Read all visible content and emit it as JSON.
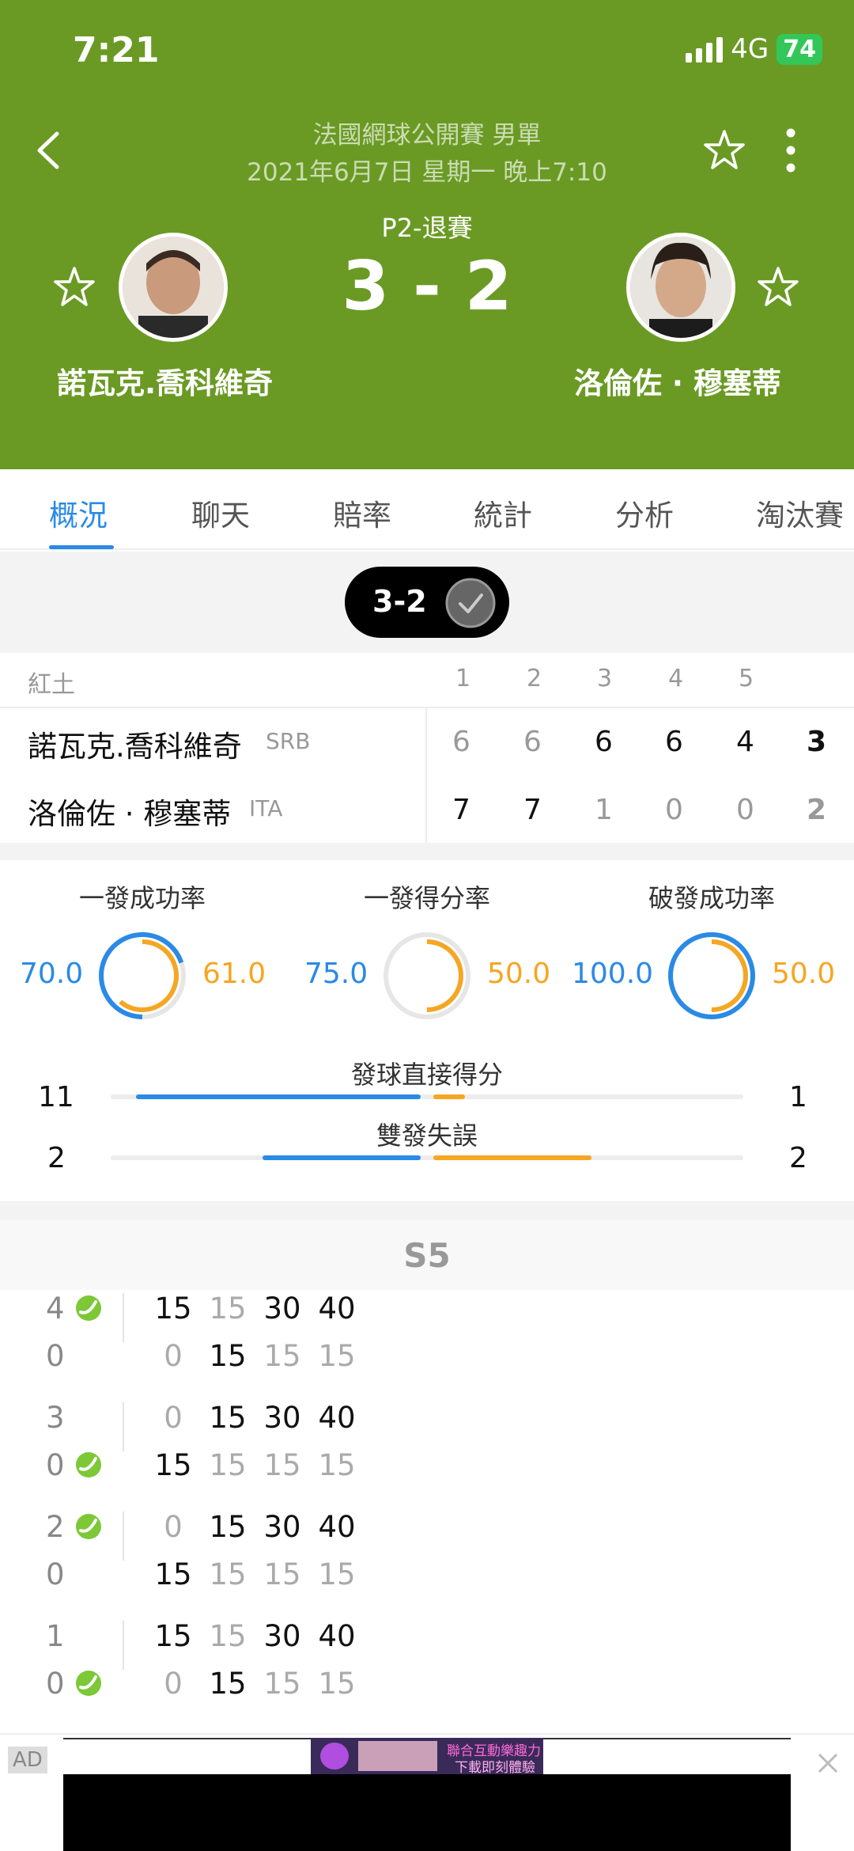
{
  "status_bar": {
    "time": "7:21",
    "network": "4G",
    "battery": "74"
  },
  "header": {
    "tournament": "法國網球公開賽 男單",
    "datetime": "2021年6月7日 星期一 晚上7:10",
    "match_status": "P2-退賽",
    "score": "3 - 2",
    "player1": {
      "name": "諾瓦克.喬科維奇"
    },
    "player2": {
      "name": "洛倫佐 · 穆塞蒂"
    }
  },
  "tabs": [
    "概況",
    "聊天",
    "賠率",
    "統計",
    "分析",
    "淘汰賽"
  ],
  "pill": {
    "score": "3-2"
  },
  "scoreboard": {
    "surface": "紅土",
    "set_headers": [
      "1",
      "2",
      "3",
      "4",
      "5"
    ],
    "rows": [
      {
        "name": "諾瓦克.喬科維奇",
        "country": "SRB",
        "sets": [
          "6",
          "6",
          "6",
          "6",
          "4"
        ],
        "total": "3"
      },
      {
        "name": "洛倫佐 · 穆塞蒂",
        "country": "ITA",
        "sets": [
          "7",
          "7",
          "1",
          "0",
          "0"
        ],
        "total": "2"
      }
    ]
  },
  "stats": {
    "circles": [
      {
        "label": "一發成功率",
        "left": "70.0",
        "right": "61.0"
      },
      {
        "label": "一發得分率",
        "left": "75.0",
        "right": "50.0"
      },
      {
        "label": "破發成功率",
        "left": "100.0",
        "right": "50.0"
      }
    ],
    "bars": [
      {
        "label": "發球直接得分",
        "left": "11",
        "right": "1"
      },
      {
        "label": "雙發失誤",
        "left": "2",
        "right": "2"
      }
    ]
  },
  "set_detail": {
    "title": "S5",
    "games": [
      {
        "top_score": "4",
        "bottom_score": "0",
        "server": "top",
        "top_points": [
          "15",
          "15",
          "30",
          "40"
        ],
        "bottom_points": [
          "0",
          "15",
          "15",
          "15"
        ],
        "top_bold": [
          1,
          0,
          1,
          1
        ],
        "bottom_bold": [
          0,
          1,
          0,
          0
        ]
      },
      {
        "top_score": "3",
        "bottom_score": "0",
        "server": "bottom",
        "top_points": [
          "0",
          "15",
          "30",
          "40"
        ],
        "bottom_points": [
          "15",
          "15",
          "15",
          "15"
        ],
        "top_bold": [
          0,
          1,
          1,
          1
        ],
        "bottom_bold": [
          1,
          0,
          0,
          0
        ]
      },
      {
        "top_score": "2",
        "bottom_score": "0",
        "server": "top",
        "top_points": [
          "0",
          "15",
          "30",
          "40"
        ],
        "bottom_points": [
          "15",
          "15",
          "15",
          "15"
        ],
        "top_bold": [
          0,
          1,
          1,
          1
        ],
        "bottom_bold": [
          1,
          0,
          0,
          0
        ]
      },
      {
        "top_score": "1",
        "bottom_score": "0",
        "server": "bottom",
        "top_points": [
          "15",
          "15",
          "30",
          "40"
        ],
        "bottom_points": [
          "0",
          "15",
          "15",
          "15"
        ],
        "top_bold": [
          1,
          0,
          1,
          1
        ],
        "bottom_bold": [
          0,
          1,
          0,
          0
        ]
      }
    ]
  },
  "ad": {
    "label": "AD",
    "text_line1": "聯合互動樂趣力",
    "text_line2": "下載即刻體驗"
  },
  "colors": {
    "header_bg": "#6a9a24",
    "accent_blue": "#2a8ae6",
    "accent_orange": "#f5a623",
    "ball_green": "#7cc836"
  }
}
